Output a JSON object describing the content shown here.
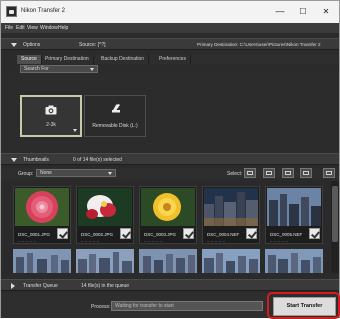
{
  "window": {
    "title": "Nikon Transfer 2",
    "minimize": "—",
    "maximize": "☐",
    "close": "✕"
  },
  "menu": [
    "File",
    "Edit",
    "View",
    "Window",
    "Help"
  ],
  "options": {
    "label": "Options",
    "source_text": "Source: [^?]",
    "destination_text": "Primary Destination: C:\\Users\\user\\Pictures\\Nikon Transfer 2",
    "tabs": [
      "Source",
      "Primary Destination",
      "Backup Destination",
      "Preferences"
    ],
    "active_tab": "Source",
    "search_for": "Search For",
    "sources": [
      {
        "label": "2-3k",
        "icon": "camera-icon",
        "selected": true
      },
      {
        "label": "Removable Disk (L:)",
        "icon": "card-reader-icon",
        "selected": false
      }
    ]
  },
  "thumbnails": {
    "label": "Thumbnails",
    "count_text": "0 of 14 file(s) selected",
    "group_label": "Group:",
    "group_value": "None",
    "select_label": "Select:",
    "items": [
      {
        "name": "DSC_0001.JPG",
        "checked": true
      },
      {
        "name": "DSC_0002.JPG",
        "checked": true
      },
      {
        "name": "DSC_0003.JPG",
        "checked": true
      },
      {
        "name": "DSC_0004.NEF",
        "checked": true
      },
      {
        "name": "DSC_0005.NEF",
        "checked": true
      }
    ]
  },
  "queue": {
    "label": "Transfer Queue",
    "count_text": "14 file(s) in the queue"
  },
  "process": {
    "label": "Process:",
    "status": "Waiting for transfer to start"
  },
  "start_button": "Start Transfer",
  "colors": {
    "highlight": "#d91a1a",
    "panel_bg": "#2b2b2b"
  }
}
